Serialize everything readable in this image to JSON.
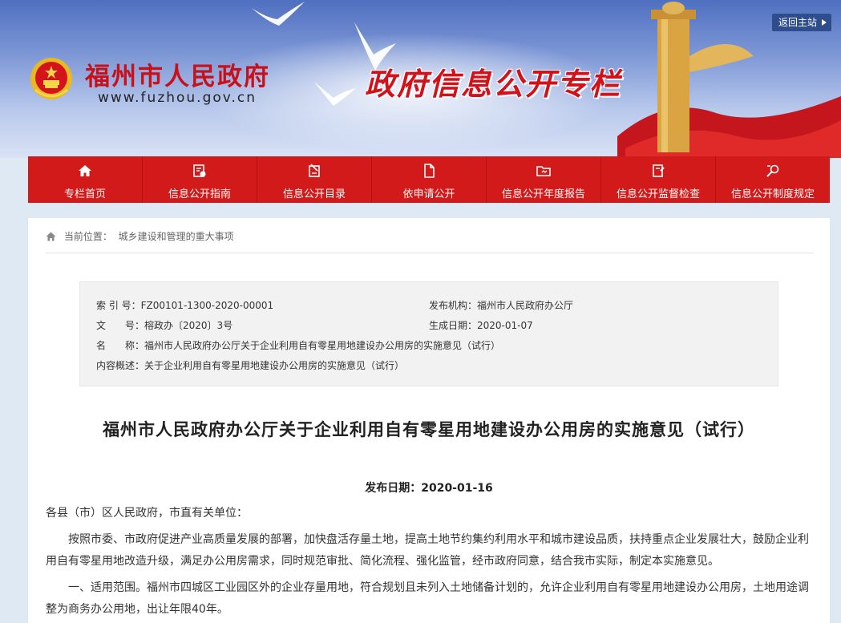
{
  "header": {
    "site_name": "福州市人民政府",
    "site_url": "www.fuzhou.gov.cn",
    "slogan": "政府信息公开专栏",
    "back_label": "返回主站"
  },
  "nav": {
    "items": [
      {
        "label": "专栏首页",
        "icon": "home-icon"
      },
      {
        "label": "信息公开指南",
        "icon": "guide-icon"
      },
      {
        "label": "信息公开目录",
        "icon": "catalog-icon"
      },
      {
        "label": "依申请公开",
        "icon": "document-icon"
      },
      {
        "label": "信息公开年度报告",
        "icon": "folder-icon"
      },
      {
        "label": "信息公开监督检查",
        "icon": "inspection-icon"
      },
      {
        "label": "信息公开制度规定",
        "icon": "search-rule-icon"
      }
    ]
  },
  "breadcrumb": {
    "prefix": "当前位置：",
    "current": "城乡建设和管理的重大事项"
  },
  "meta": {
    "index_label": "索 引 号：",
    "index_value": "FZ00101-1300-2020-00001",
    "issuer_label": "发布机构：",
    "issuer_value": "福州市人民政府办公厅",
    "docno_label": "文　　号：",
    "docno_value": "榕政办〔2020〕3号",
    "created_label": "生成日期：",
    "created_value": "2020-01-07",
    "name_label": "名　　称：",
    "name_value": "福州市人民政府办公厅关于企业利用自有零星用地建设办公用房的实施意见（试行）",
    "summary_label": "内容概述：",
    "summary_value": "关于企业利用自有零星用地建设办公用房的实施意见（试行）"
  },
  "article": {
    "title": "福州市人民政府办公厅关于企业利用自有零星用地建设办公用房的实施意见（试行）",
    "pub_date": "发布日期：2020-01-16",
    "salutation": "各县（市）区人民政府，市直有关单位：",
    "para1": "按照市委、市政府促进产业高质量发展的部署，加快盘活存量土地，提高土地节约集约利用水平和城市建设品质，扶持重点企业发展壮大，鼓励企业利用自有零星用地改造升级，满足办公用房需求，同时规范审批、简化流程、强化监管，经市政府同意，结合我市实际，制定本实施意见。",
    "para2": "一、适用范围。福州市四城区工业园区外的企业存量用地，符合规划且未列入土地储备计划的，允许企业利用自有零星用地建设办公用房，土地用途调整为商务办公用地，出让年限40年。"
  },
  "colors": {
    "nav_red": "#d31a1a",
    "brand_red": "#c8101a",
    "meta_bg": "#f2f2f2"
  }
}
